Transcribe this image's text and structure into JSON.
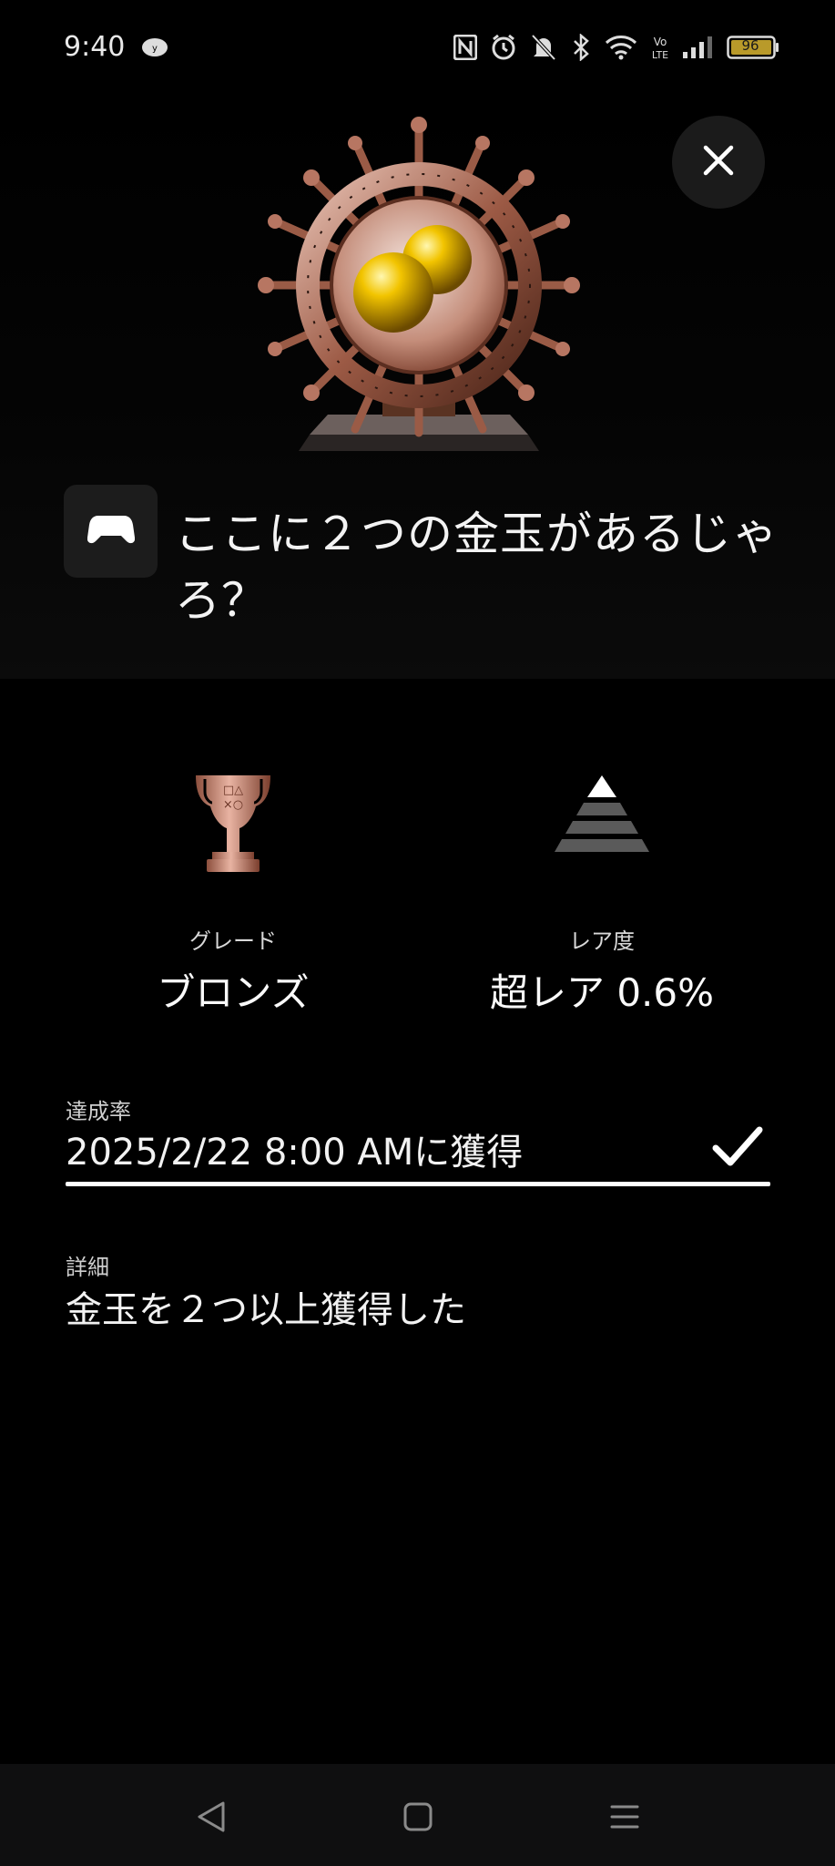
{
  "status_bar": {
    "time": "9:40",
    "battery": "96",
    "icons": [
      "app-badge-icon",
      "nfc-icon",
      "alarm-icon",
      "mute-icon",
      "bluetooth-icon",
      "wifi-icon",
      "volte-icon",
      "signal-icon",
      "battery-icon"
    ]
  },
  "trophy": {
    "title": "ここに２つの金玉があるじゃろ？",
    "art_icon": "ship-wheel-golden-balls-icon",
    "platform_icon": "gamepad-icon"
  },
  "stats": {
    "grade": {
      "label": "グレード",
      "value": "ブロンズ",
      "icon": "bronze-trophy-icon"
    },
    "rarity": {
      "label": "レア度",
      "value": "超レア 0.6%",
      "icon": "rarity-pyramid-icon"
    }
  },
  "achievement": {
    "label": "達成率",
    "value": "2025/2/22  8:00 AMに獲得",
    "progress": 1.0,
    "status_icon": "check-icon"
  },
  "detail": {
    "label": "詳細",
    "value": "金玉を２つ以上獲得した"
  },
  "colors": {
    "background": "#000000",
    "bronze": "#b87a66",
    "gold": "#e0b000"
  }
}
